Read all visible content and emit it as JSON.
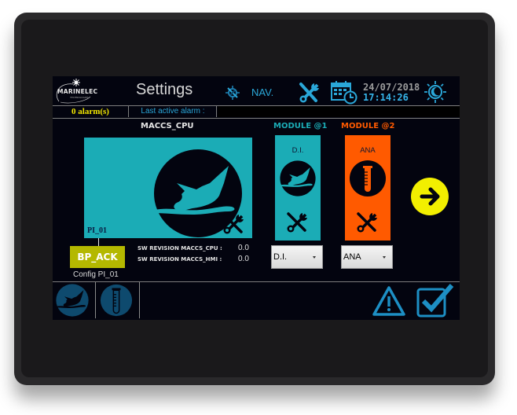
{
  "header": {
    "logo_text": "MARINELEC",
    "logo_subtext": "TECHNOLOGIES",
    "title": "Settings",
    "nav_icon": "compass-icon",
    "nav_label": "NAV.",
    "tools_icon": "tools-icon",
    "calendar_icon": "calendar-clock-icon",
    "date": "24/07/2018",
    "time": "17:14:26",
    "day_night_icon": "day-night-icon"
  },
  "alarm_bar": {
    "alarm_count": "0  alarm(s)",
    "last_active_label": "Last active alarm :",
    "last_active_value": ""
  },
  "cpu": {
    "title": "MACCS_CPU",
    "icon": "ship-icon",
    "port_label": "PI_01",
    "tools_icon": "tools-icon",
    "ack_button": "BP_ACK",
    "config_label": "Config PI_01",
    "sw_revisions": [
      {
        "label": "SW REVISION MACCS_CPU :",
        "value": "0.0"
      },
      {
        "label": "SW REVISION MACCS_HMI :",
        "value": "0.0"
      }
    ]
  },
  "modules": [
    {
      "title": "MODULE @1",
      "type_label": "D.I.",
      "icon": "ship-icon",
      "selected": "D.I.",
      "color": "#1bacb6",
      "title_color": "#1bacb6"
    },
    {
      "title": "MODULE @2",
      "type_label": "ANA",
      "icon": "test-tube-icon",
      "selected": "ANA",
      "color": "#ff5a00",
      "title_color": "#ff5a00"
    }
  ],
  "navigation": {
    "next_icon": "arrow-right-icon"
  },
  "footer": {
    "tabs": [
      {
        "icon": "ship-icon"
      },
      {
        "icon": "test-tube-icon"
      }
    ],
    "warning_icon": "warning-icon",
    "validate_icon": "checkbox-check-icon"
  },
  "colors": {
    "accent_blue": "#2aa7d8",
    "cyan": "#1bacb6",
    "orange": "#ff5a00",
    "yellow": "#f2ef00",
    "ack_olive": "#b4b800",
    "footer_icon": "#0e4a6e"
  }
}
